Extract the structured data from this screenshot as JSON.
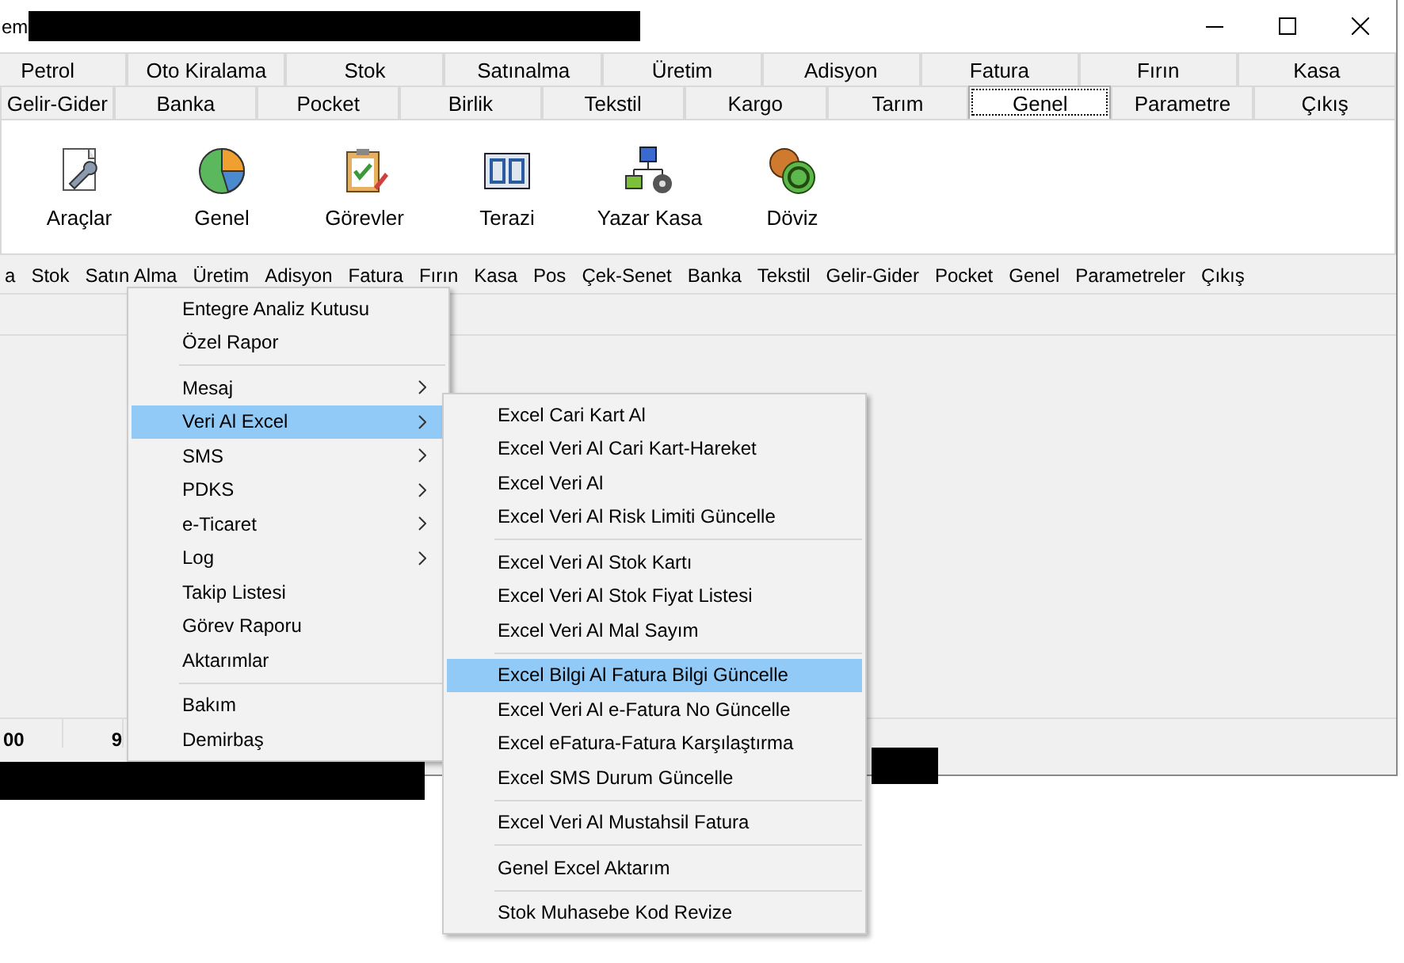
{
  "window": {
    "title": "em"
  },
  "tab_rows": [
    [
      {
        "label": "Petrol",
        "selected": false
      },
      {
        "label": "Oto Kiralama",
        "selected": false
      },
      {
        "label": "Stok",
        "selected": false
      },
      {
        "label": "Satınalma",
        "selected": false
      },
      {
        "label": "Üretim",
        "selected": false
      },
      {
        "label": "Adisyon",
        "selected": false
      },
      {
        "label": "Fatura",
        "selected": false
      },
      {
        "label": "Fırın",
        "selected": false
      },
      {
        "label": "Kasa",
        "selected": false
      }
    ],
    [
      {
        "label": "Gelir-Gider",
        "selected": false
      },
      {
        "label": "Banka",
        "selected": false
      },
      {
        "label": "Pocket",
        "selected": false
      },
      {
        "label": "Birlik",
        "selected": false
      },
      {
        "label": "Tekstil",
        "selected": false
      },
      {
        "label": "Kargo",
        "selected": false
      },
      {
        "label": "Tarım",
        "selected": false
      },
      {
        "label": "Genel",
        "selected": true
      },
      {
        "label": "Parametre",
        "selected": false
      },
      {
        "label": "Çıkış",
        "selected": false
      }
    ]
  ],
  "toolbar": [
    {
      "label": "Araçlar",
      "kind": "tools"
    },
    {
      "label": "Genel",
      "kind": "chart"
    },
    {
      "label": "Görevler",
      "kind": "tasks"
    },
    {
      "label": "Terazi",
      "kind": "scale"
    },
    {
      "label": "Yazar Kasa",
      "kind": "network"
    },
    {
      "label": "Döviz",
      "kind": "coins"
    }
  ],
  "menu_bar": [
    "a",
    "Stok",
    "Satın Alma",
    "Üretim",
    "Adisyon",
    "Fatura",
    "Fırın",
    "Kasa",
    "Pos",
    "Çek-Senet",
    "Banka",
    "Tekstil",
    "Gelir-Gider",
    "Pocket",
    "Genel",
    "Parametreler",
    "Çıkış"
  ],
  "status_cells": [
    "00",
    "9"
  ],
  "context_menu": [
    {
      "kind": "item",
      "label": "Entegre Analiz Kutusu",
      "submenu": false,
      "selected": false
    },
    {
      "kind": "item",
      "label": "Özel Rapor",
      "submenu": false,
      "selected": false
    },
    {
      "kind": "separator"
    },
    {
      "kind": "item",
      "label": "Mesaj",
      "submenu": true,
      "selected": false
    },
    {
      "kind": "item",
      "label": "Veri Al Excel",
      "submenu": true,
      "selected": true
    },
    {
      "kind": "item",
      "label": "SMS",
      "submenu": true,
      "selected": false
    },
    {
      "kind": "item",
      "label": "PDKS",
      "submenu": true,
      "selected": false
    },
    {
      "kind": "item",
      "label": "e-Ticaret",
      "submenu": true,
      "selected": false
    },
    {
      "kind": "item",
      "label": "Log",
      "submenu": true,
      "selected": false
    },
    {
      "kind": "item",
      "label": "Takip Listesi",
      "submenu": false,
      "selected": false
    },
    {
      "kind": "item",
      "label": "Görev Raporu",
      "submenu": false,
      "selected": false
    },
    {
      "kind": "item",
      "label": "Aktarımlar",
      "submenu": false,
      "selected": false
    },
    {
      "kind": "separator"
    },
    {
      "kind": "item",
      "label": "Bakım",
      "submenu": false,
      "selected": false
    },
    {
      "kind": "item",
      "label": "Demirbaş",
      "submenu": false,
      "selected": false
    }
  ],
  "submenu": [
    {
      "kind": "item",
      "label": "Excel Cari Kart Al",
      "selected": false
    },
    {
      "kind": "item",
      "label": "Excel Veri Al Cari Kart-Hareket",
      "selected": false
    },
    {
      "kind": "item",
      "label": "Excel Veri Al",
      "selected": false
    },
    {
      "kind": "item",
      "label": "Excel Veri Al Risk Limiti Güncelle",
      "selected": false
    },
    {
      "kind": "separator"
    },
    {
      "kind": "item",
      "label": "Excel Veri Al Stok Kartı",
      "selected": false
    },
    {
      "kind": "item",
      "label": "Excel Veri Al Stok Fiyat Listesi",
      "selected": false
    },
    {
      "kind": "item",
      "label": "Excel Veri Al Mal Sayım",
      "selected": false
    },
    {
      "kind": "separator"
    },
    {
      "kind": "item",
      "label": "Excel Bilgi Al Fatura Bilgi Güncelle",
      "selected": true
    },
    {
      "kind": "item",
      "label": "Excel Veri Al e-Fatura No Güncelle",
      "selected": false
    },
    {
      "kind": "item",
      "label": "Excel eFatura-Fatura Karşılaştırma",
      "selected": false
    },
    {
      "kind": "item",
      "label": "Excel SMS Durum Güncelle",
      "selected": false
    },
    {
      "kind": "separator"
    },
    {
      "kind": "item",
      "label": "Excel Veri Al Mustahsil Fatura",
      "selected": false
    },
    {
      "kind": "separator"
    },
    {
      "kind": "item",
      "label": "Genel Excel Aktarım",
      "selected": false
    },
    {
      "kind": "separator"
    },
    {
      "kind": "item",
      "label": "Stok Muhasebe Kod Revize",
      "selected": false
    }
  ]
}
